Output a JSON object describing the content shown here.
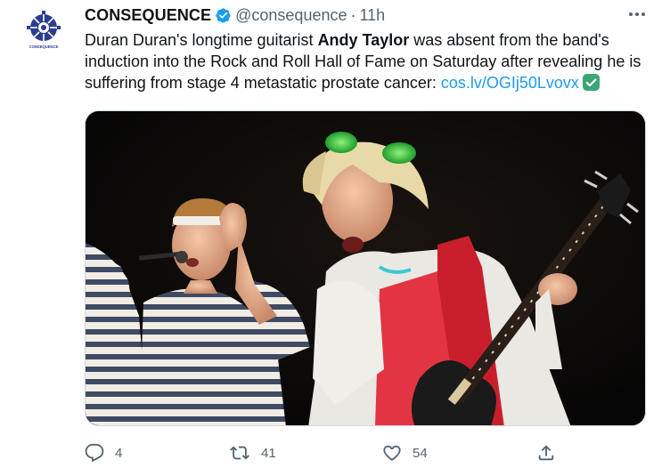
{
  "account": {
    "display_name": "CONSEQUENCE",
    "handle": "@consequence",
    "separator": "·",
    "time": "11h",
    "verified": true,
    "avatar_label": "CONSEQUENCE"
  },
  "tweet": {
    "text_before": "Duran Duran's longtime guitarist ",
    "text_bold": "Andy Taylor",
    "text_after": " was absent from the band's induction into the Rock and Roll Hall of Fame on Saturday after revealing he is suffering from stage 4 metastatic prostate cancer: ",
    "link": "cos.lv/OGIj50Lvovx"
  },
  "actions": {
    "reply_count": "4",
    "retweet_count": "41",
    "like_count": "54"
  },
  "colors": {
    "brand_blue": "#1d9bf0",
    "text_primary": "#0f1419",
    "text_secondary": "#536471",
    "check_green": "#3aa675",
    "avatar_navy": "#2b3d8f"
  },
  "icons": {
    "verified": "verified-badge-icon",
    "more": "more-options-icon",
    "reply": "reply-icon",
    "retweet": "retweet-icon",
    "like": "heart-icon",
    "share": "share-icon",
    "link_check": "check-mark-icon"
  }
}
